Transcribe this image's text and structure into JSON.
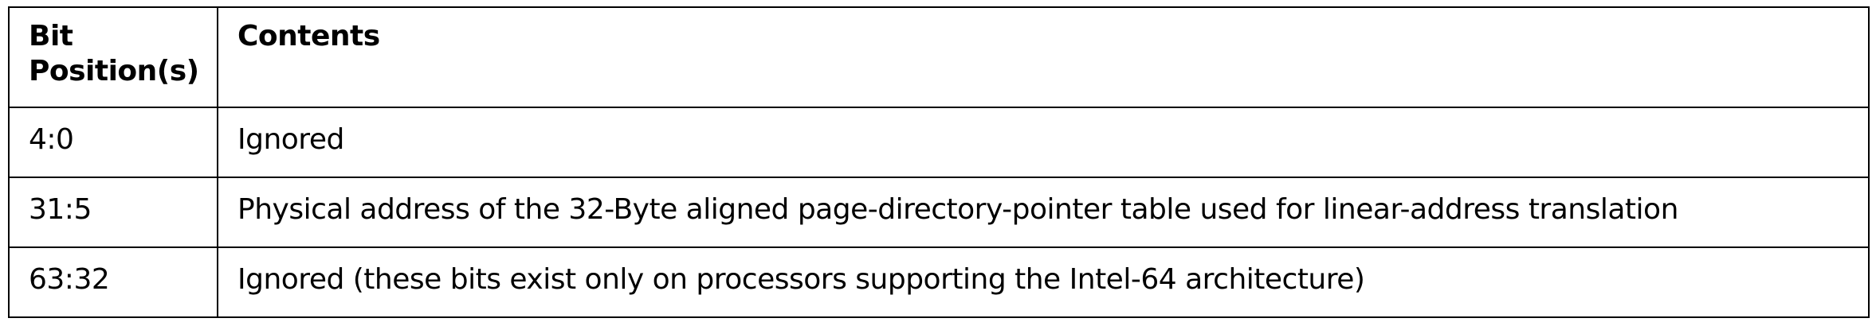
{
  "table": {
    "header": {
      "bit_line1": "Bit",
      "bit_line2": "Position(s)",
      "contents": "Contents"
    },
    "rows": [
      {
        "bits": "4:0",
        "contents": "Ignored"
      },
      {
        "bits": "31:5",
        "contents": "Physical address of the 32-Byte aligned page-directory-pointer table used for linear-address translation"
      },
      {
        "bits": "63:32",
        "contents": "Ignored (these bits exist only on processors supporting the Intel-64 architecture)"
      }
    ]
  }
}
